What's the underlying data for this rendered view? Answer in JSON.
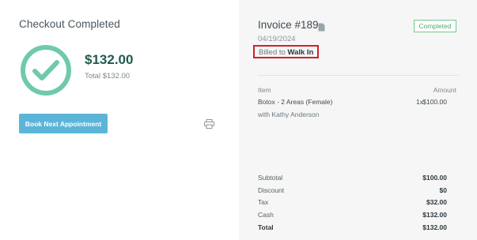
{
  "checkout": {
    "title": "Checkout Completed",
    "amount": "$132.00",
    "total_line": "Total $132.00",
    "book_button": "Book Next Appointment"
  },
  "invoice": {
    "title": "Invoice #189",
    "status": "Completed",
    "date": "04/19/2024",
    "billed_prefix": "Billed to",
    "billed_name": "Walk In",
    "columns": {
      "item": "Item",
      "amount": "Amount"
    },
    "line_item": {
      "name": "Botox - 2 Areas (Female)",
      "qty": "1x",
      "price": "$100.00",
      "provider": "with Kathy Anderson"
    },
    "summary": [
      {
        "label": "Subtotal",
        "value": "$100.00"
      },
      {
        "label": "Discount",
        "value": "$0"
      },
      {
        "label": "Tax",
        "value": "$32.00"
      },
      {
        "label": "Cash",
        "value": "$132.00"
      },
      {
        "label": "Total",
        "value": "$132.00"
      }
    ]
  },
  "icons": {
    "check": "check-circle-icon",
    "print": "printer-icon",
    "document": "document-icon"
  },
  "colors": {
    "accent": "#6fcaa9",
    "button": "#5bb5d8",
    "status": "#4fae6c",
    "highlight": "#d51f2a"
  }
}
